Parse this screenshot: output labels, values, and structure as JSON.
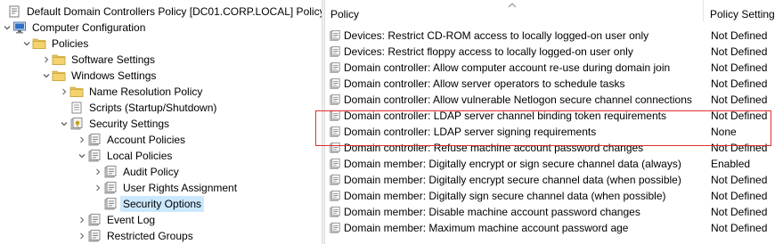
{
  "tree": {
    "items": [
      {
        "label": "Default Domain Controllers Policy [DC01.CORP.LOCAL] Policy",
        "icon": "policy-scroll-icon",
        "expander": "none"
      },
      {
        "label": "Computer Configuration",
        "icon": "computer-icon",
        "expander": "expanded"
      },
      {
        "label": "Policies",
        "icon": "folder-icon",
        "expander": "expanded"
      },
      {
        "label": "Software Settings",
        "icon": "folder-icon",
        "expander": "collapsed"
      },
      {
        "label": "Windows Settings",
        "icon": "folder-icon",
        "expander": "expanded"
      },
      {
        "label": "Name Resolution Policy",
        "icon": "folder-icon",
        "expander": "collapsed"
      },
      {
        "label": "Scripts (Startup/Shutdown)",
        "icon": "script-icon",
        "expander": "none"
      },
      {
        "label": "Security Settings",
        "icon": "security-settings-icon",
        "expander": "expanded"
      },
      {
        "label": "Account Policies",
        "icon": "policy-folder-icon",
        "expander": "collapsed"
      },
      {
        "label": "Local Policies",
        "icon": "policy-folder-icon",
        "expander": "expanded"
      },
      {
        "label": "Audit Policy",
        "icon": "policy-folder-icon",
        "expander": "collapsed"
      },
      {
        "label": "User Rights Assignment",
        "icon": "policy-folder-icon",
        "expander": "collapsed"
      },
      {
        "label": "Security Options",
        "icon": "policy-folder-icon",
        "expander": "none"
      },
      {
        "label": "Event Log",
        "icon": "policy-folder-icon",
        "expander": "collapsed"
      },
      {
        "label": "Restricted Groups",
        "icon": "policy-folder-icon",
        "expander": "collapsed"
      }
    ],
    "selected": "Security Options"
  },
  "list": {
    "columns": {
      "policy": "Policy",
      "setting": "Policy Setting"
    },
    "rows": [
      {
        "policy": "Devices: Restrict CD-ROM access to locally logged-on user only",
        "setting": "Not Defined"
      },
      {
        "policy": "Devices: Restrict floppy access to locally logged-on user only",
        "setting": "Not Defined"
      },
      {
        "policy": "Domain controller: Allow computer account re-use during domain join",
        "setting": "Not Defined"
      },
      {
        "policy": "Domain controller: Allow server operators to schedule tasks",
        "setting": "Not Defined"
      },
      {
        "policy": "Domain controller: Allow vulnerable Netlogon secure channel connections",
        "setting": "Not Defined"
      },
      {
        "policy": "Domain controller: LDAP server channel binding token requirements",
        "setting": "Not Defined"
      },
      {
        "policy": "Domain controller: LDAP server signing requirements",
        "setting": "None"
      },
      {
        "policy": "Domain controller: Refuse machine account password changes",
        "setting": "Not Defined"
      },
      {
        "policy": "Domain member: Digitally encrypt or sign secure channel data (always)",
        "setting": "Enabled"
      },
      {
        "policy": "Domain member: Digitally encrypt secure channel data (when possible)",
        "setting": "Not Defined"
      },
      {
        "policy": "Domain member: Digitally sign secure channel data (when possible)",
        "setting": "Not Defined"
      },
      {
        "policy": "Domain member: Disable machine account password changes",
        "setting": "Not Defined"
      },
      {
        "policy": "Domain member: Maximum machine account password age",
        "setting": "Not Defined"
      }
    ],
    "highlight_color": "#e03030"
  },
  "colors": {
    "selection": "#cce8ff",
    "folder": "#e8c35a"
  }
}
